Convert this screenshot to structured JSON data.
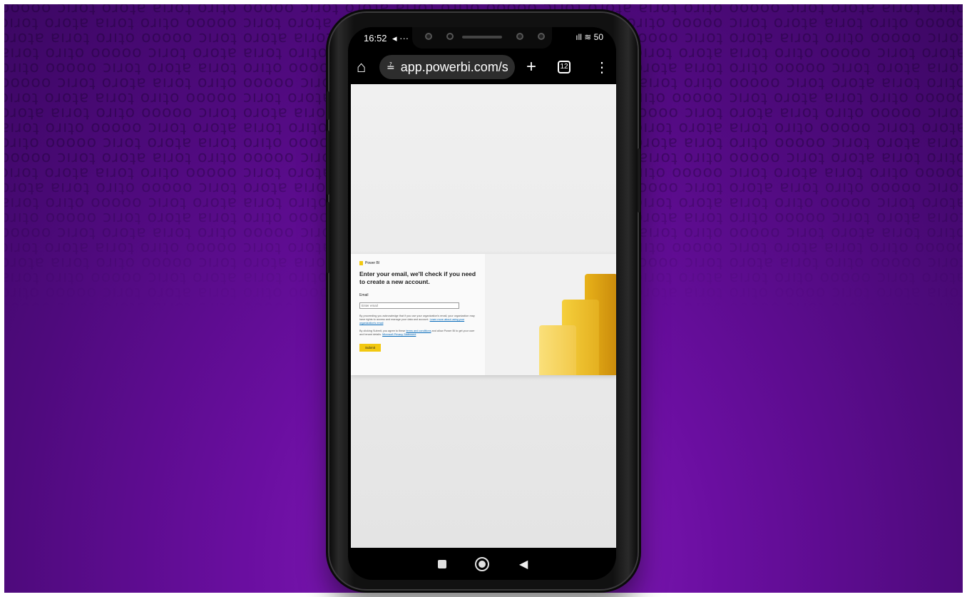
{
  "status_bar": {
    "time": "16:52",
    "indicators": "◂ ···",
    "right_icons": "ıll ≋ 50"
  },
  "browser": {
    "home_icon": "⌂",
    "tune_icon": "≟",
    "url": "app.powerbi.com/s",
    "new_tab_icon": "+",
    "tab_count": "12",
    "menu_icon": "⋮"
  },
  "page": {
    "brand": "Power BI",
    "heading": "Enter your email, we'll check if you need to create a new account.",
    "email_label": "Email",
    "email_placeholder": "Enter email",
    "fine_print_1": "By proceeding you acknowledge that if you use your organization's email, your organization may have rights to access and manage your data and account.",
    "fine_print_1_link": "Learn more about using your organization's email",
    "fine_print_2": "By clicking Submit, you agree to these",
    "fine_print_2_link_1": "terms and conditions",
    "fine_print_2_mid": "and allow Power BI to get your user and tenant details.",
    "fine_print_2_link_2": "Microsoft Privacy Statement",
    "submit_label": "Submit"
  },
  "colors": {
    "accent": "#f2c811",
    "background": "#5a0d8a",
    "link": "#0067b8"
  },
  "nav_bar": {
    "recents_icon": "square-icon",
    "home_icon": "circle-icon",
    "back_icon": "◀"
  }
}
